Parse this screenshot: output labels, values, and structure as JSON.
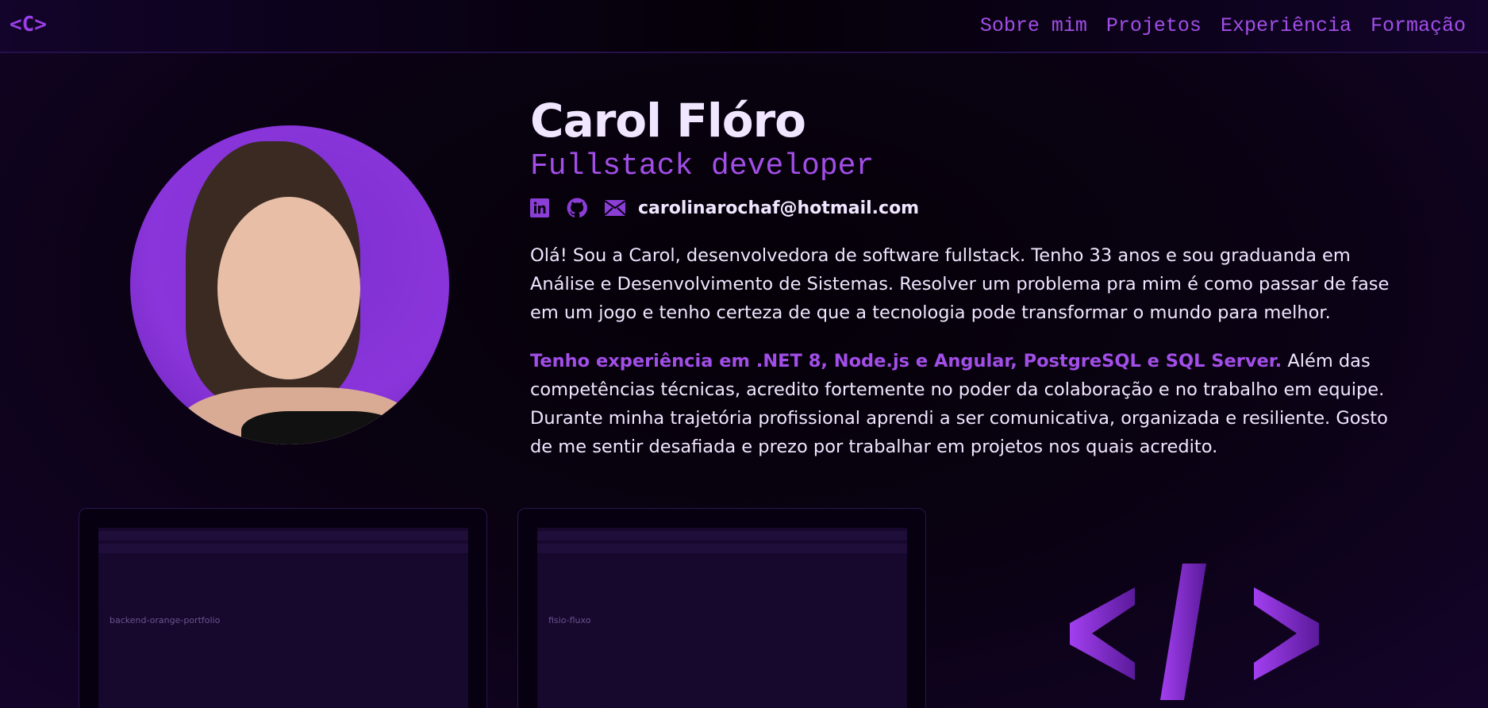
{
  "header": {
    "logo": "<C>",
    "nav": [
      "Sobre mim",
      "Projetos",
      "Experiência",
      "Formação"
    ]
  },
  "hero": {
    "name": "Carol Flóro",
    "role": "Fullstack developer",
    "email": "carolinarochaf@hotmail.com",
    "about1": "Olá! Sou a Carol, desenvolvedora de software fullstack. Tenho 33 anos e sou graduanda em Análise e Desenvolvimento de Sistemas. Resolver um problema pra mim é como passar de fase em um jogo e tenho certeza de que a tecnologia pode transformar o mundo para melhor.",
    "about2_highlight": "Tenho experiência em .NET 8, Node.js e Angular, PostgreSQL e SQL Server.",
    "about2_rest": " Além das competências técnicas, acredito fortemente no poder da colaboração e no trabalho em equipe. Durante minha trajetória profissional aprendi a ser comunicativa, organizada e resiliente. Gosto de me sentir desafiada e prezo por trabalhar em projetos nos quais acredito."
  },
  "projects": [
    {
      "repo": "backend-orange-portfolio"
    },
    {
      "repo": "fisio-fluxo"
    }
  ],
  "colors": {
    "accent": "#a24ee8",
    "text": "#f1e6ff",
    "bg": "#0a0212"
  }
}
